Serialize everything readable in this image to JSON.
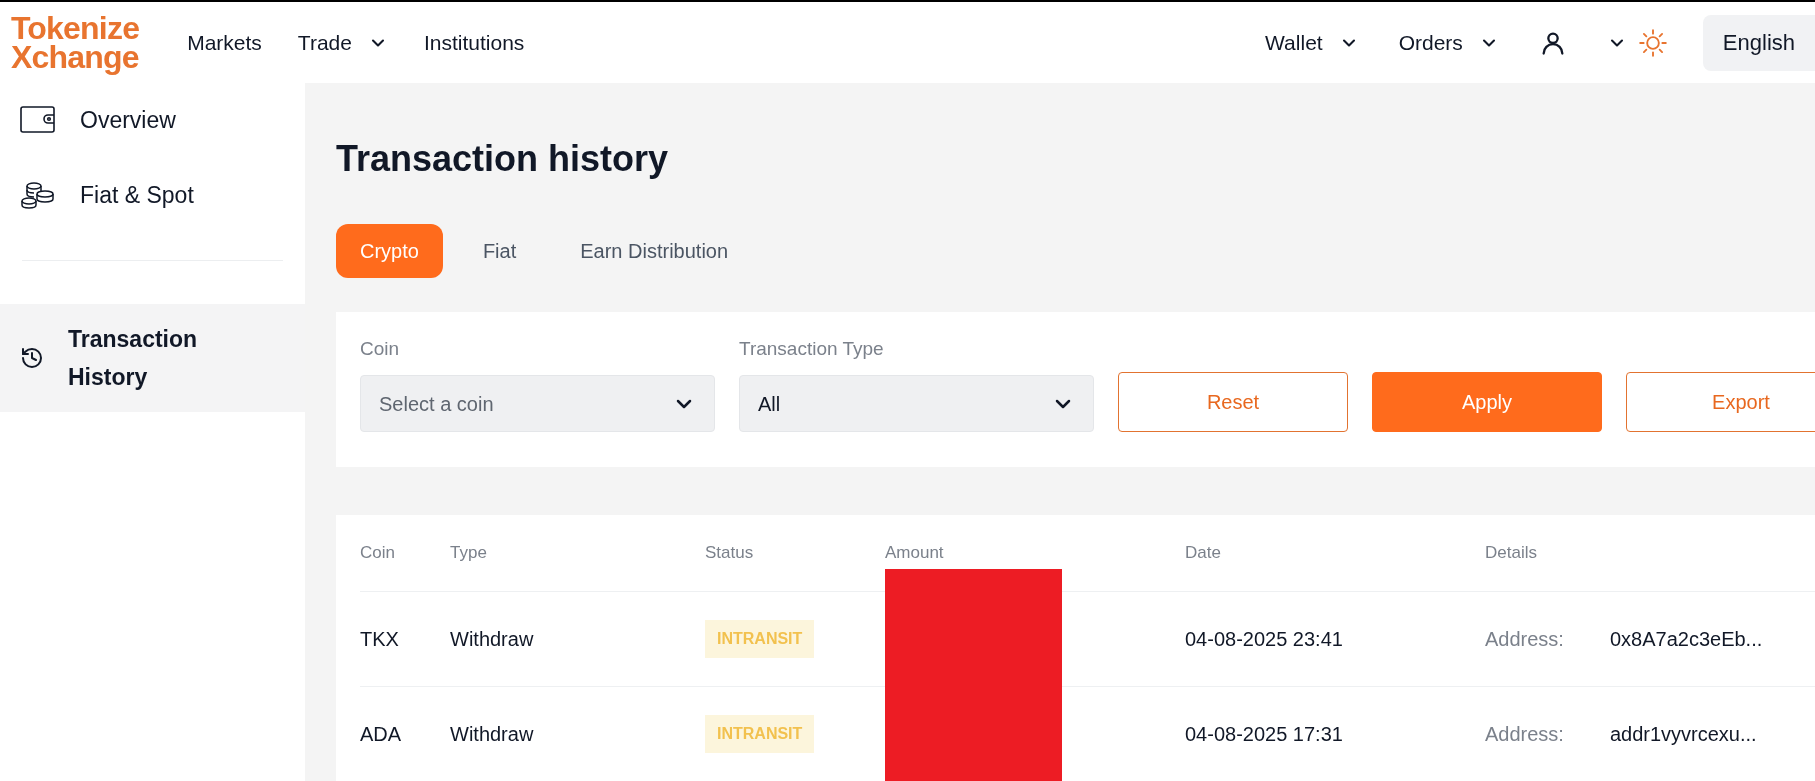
{
  "header": {
    "logo": [
      "Tokenize",
      "Xchange"
    ],
    "nav": [
      {
        "label": "Markets",
        "dropdown": false
      },
      {
        "label": "Trade",
        "dropdown": true
      },
      {
        "label": "Institutions",
        "dropdown": false
      }
    ],
    "right_nav": [
      {
        "label": "Wallet",
        "dropdown": true
      },
      {
        "label": "Orders",
        "dropdown": true
      }
    ],
    "language": "English"
  },
  "sidebar": {
    "items": [
      {
        "label": "Overview",
        "kind": "wallet",
        "selected": false
      },
      {
        "label": "Fiat & Spot",
        "kind": "coins",
        "selected": false
      }
    ],
    "bottom_items": [
      {
        "label": "Transaction History",
        "kind": "history",
        "selected": true
      }
    ]
  },
  "title": "Transaction history",
  "tabs": [
    {
      "label": "Crypto",
      "selected": true
    },
    {
      "label": "Fiat",
      "selected": false
    },
    {
      "label": "Earn Distribution",
      "selected": false
    }
  ],
  "filters": {
    "coin": {
      "label": "Coin",
      "placeholder": "Select a coin"
    },
    "type": {
      "label": "Transaction Type",
      "value": "All"
    },
    "buttons": [
      {
        "label": "Reset",
        "kind": "outline"
      },
      {
        "label": "Apply",
        "kind": "primary"
      },
      {
        "label": "Export",
        "kind": "outline"
      }
    ]
  },
  "table": {
    "columns": [
      "Coin",
      "Type",
      "Status",
      "Amount",
      "Date",
      "Details"
    ],
    "rows": [
      {
        "coin": "TKX",
        "type": "Withdraw",
        "status": "INTRANSIT",
        "amount_redacted": true,
        "date": "04-08-2025 23:41",
        "detail_label": "Address:",
        "detail_value": "0x8A7a2c3eEb..."
      },
      {
        "coin": "ADA",
        "type": "Withdraw",
        "status": "INTRANSIT",
        "amount_redacted": true,
        "date": "04-08-2025 17:31",
        "detail_label": "Address:",
        "detail_value": "addr1vyvrcexu..."
      }
    ]
  }
}
